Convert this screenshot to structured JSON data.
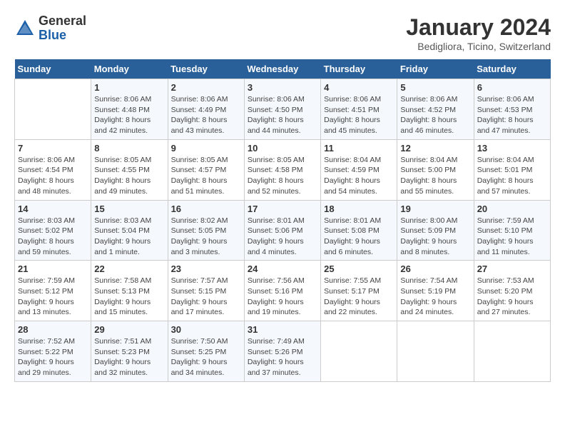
{
  "header": {
    "logo_general": "General",
    "logo_blue": "Blue",
    "title": "January 2024",
    "subtitle": "Bedigliora, Ticino, Switzerland"
  },
  "calendar": {
    "days_of_week": [
      "Sunday",
      "Monday",
      "Tuesday",
      "Wednesday",
      "Thursday",
      "Friday",
      "Saturday"
    ],
    "weeks": [
      [
        {
          "day": "",
          "info": ""
        },
        {
          "day": "1",
          "info": "Sunrise: 8:06 AM\nSunset: 4:48 PM\nDaylight: 8 hours\nand 42 minutes."
        },
        {
          "day": "2",
          "info": "Sunrise: 8:06 AM\nSunset: 4:49 PM\nDaylight: 8 hours\nand 43 minutes."
        },
        {
          "day": "3",
          "info": "Sunrise: 8:06 AM\nSunset: 4:50 PM\nDaylight: 8 hours\nand 44 minutes."
        },
        {
          "day": "4",
          "info": "Sunrise: 8:06 AM\nSunset: 4:51 PM\nDaylight: 8 hours\nand 45 minutes."
        },
        {
          "day": "5",
          "info": "Sunrise: 8:06 AM\nSunset: 4:52 PM\nDaylight: 8 hours\nand 46 minutes."
        },
        {
          "day": "6",
          "info": "Sunrise: 8:06 AM\nSunset: 4:53 PM\nDaylight: 8 hours\nand 47 minutes."
        }
      ],
      [
        {
          "day": "7",
          "info": "Sunrise: 8:06 AM\nSunset: 4:54 PM\nDaylight: 8 hours\nand 48 minutes."
        },
        {
          "day": "8",
          "info": "Sunrise: 8:05 AM\nSunset: 4:55 PM\nDaylight: 8 hours\nand 49 minutes."
        },
        {
          "day": "9",
          "info": "Sunrise: 8:05 AM\nSunset: 4:57 PM\nDaylight: 8 hours\nand 51 minutes."
        },
        {
          "day": "10",
          "info": "Sunrise: 8:05 AM\nSunset: 4:58 PM\nDaylight: 8 hours\nand 52 minutes."
        },
        {
          "day": "11",
          "info": "Sunrise: 8:04 AM\nSunset: 4:59 PM\nDaylight: 8 hours\nand 54 minutes."
        },
        {
          "day": "12",
          "info": "Sunrise: 8:04 AM\nSunset: 5:00 PM\nDaylight: 8 hours\nand 55 minutes."
        },
        {
          "day": "13",
          "info": "Sunrise: 8:04 AM\nSunset: 5:01 PM\nDaylight: 8 hours\nand 57 minutes."
        }
      ],
      [
        {
          "day": "14",
          "info": "Sunrise: 8:03 AM\nSunset: 5:02 PM\nDaylight: 8 hours\nand 59 minutes."
        },
        {
          "day": "15",
          "info": "Sunrise: 8:03 AM\nSunset: 5:04 PM\nDaylight: 9 hours\nand 1 minute."
        },
        {
          "day": "16",
          "info": "Sunrise: 8:02 AM\nSunset: 5:05 PM\nDaylight: 9 hours\nand 3 minutes."
        },
        {
          "day": "17",
          "info": "Sunrise: 8:01 AM\nSunset: 5:06 PM\nDaylight: 9 hours\nand 4 minutes."
        },
        {
          "day": "18",
          "info": "Sunrise: 8:01 AM\nSunset: 5:08 PM\nDaylight: 9 hours\nand 6 minutes."
        },
        {
          "day": "19",
          "info": "Sunrise: 8:00 AM\nSunset: 5:09 PM\nDaylight: 9 hours\nand 8 minutes."
        },
        {
          "day": "20",
          "info": "Sunrise: 7:59 AM\nSunset: 5:10 PM\nDaylight: 9 hours\nand 11 minutes."
        }
      ],
      [
        {
          "day": "21",
          "info": "Sunrise: 7:59 AM\nSunset: 5:12 PM\nDaylight: 9 hours\nand 13 minutes."
        },
        {
          "day": "22",
          "info": "Sunrise: 7:58 AM\nSunset: 5:13 PM\nDaylight: 9 hours\nand 15 minutes."
        },
        {
          "day": "23",
          "info": "Sunrise: 7:57 AM\nSunset: 5:15 PM\nDaylight: 9 hours\nand 17 minutes."
        },
        {
          "day": "24",
          "info": "Sunrise: 7:56 AM\nSunset: 5:16 PM\nDaylight: 9 hours\nand 19 minutes."
        },
        {
          "day": "25",
          "info": "Sunrise: 7:55 AM\nSunset: 5:17 PM\nDaylight: 9 hours\nand 22 minutes."
        },
        {
          "day": "26",
          "info": "Sunrise: 7:54 AM\nSunset: 5:19 PM\nDaylight: 9 hours\nand 24 minutes."
        },
        {
          "day": "27",
          "info": "Sunrise: 7:53 AM\nSunset: 5:20 PM\nDaylight: 9 hours\nand 27 minutes."
        }
      ],
      [
        {
          "day": "28",
          "info": "Sunrise: 7:52 AM\nSunset: 5:22 PM\nDaylight: 9 hours\nand 29 minutes."
        },
        {
          "day": "29",
          "info": "Sunrise: 7:51 AM\nSunset: 5:23 PM\nDaylight: 9 hours\nand 32 minutes."
        },
        {
          "day": "30",
          "info": "Sunrise: 7:50 AM\nSunset: 5:25 PM\nDaylight: 9 hours\nand 34 minutes."
        },
        {
          "day": "31",
          "info": "Sunrise: 7:49 AM\nSunset: 5:26 PM\nDaylight: 9 hours\nand 37 minutes."
        },
        {
          "day": "",
          "info": ""
        },
        {
          "day": "",
          "info": ""
        },
        {
          "day": "",
          "info": ""
        }
      ]
    ]
  }
}
